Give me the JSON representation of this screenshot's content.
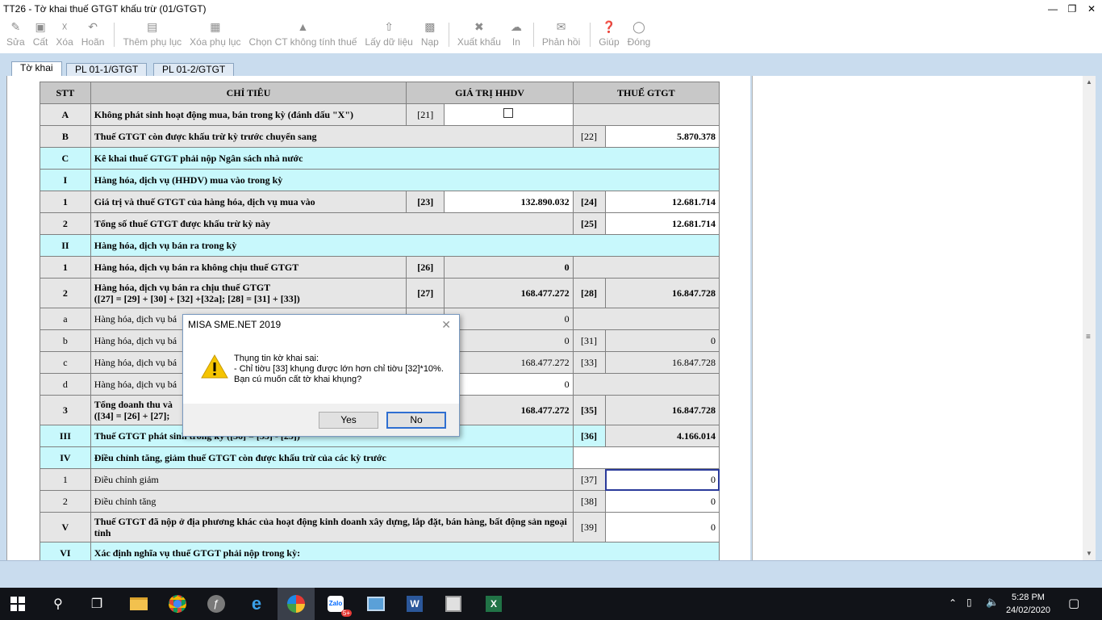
{
  "window": {
    "title": "TT26 - Tờ khai thuế GTGT khấu trừ (01/GTGT)"
  },
  "toolbar": {
    "items": [
      {
        "label": "Sửa",
        "icon": "edit-icon"
      },
      {
        "label": "Cất",
        "icon": "save-icon"
      },
      {
        "label": "Xóa",
        "icon": "delete-icon"
      },
      {
        "label": "Hoãn",
        "icon": "undo-icon"
      },
      {
        "label": "Thêm phụ lục",
        "icon": "add-appendix-icon"
      },
      {
        "label": "Xóa phụ lục",
        "icon": "delete-appendix-icon"
      },
      {
        "label": "Chọn CT không tính thuế",
        "icon": "select-document-icon"
      },
      {
        "label": "Lấy dữ liệu",
        "icon": "fetch-data-icon"
      },
      {
        "label": "Nạp",
        "icon": "load-icon"
      },
      {
        "label": "Xuất khẩu",
        "icon": "export-icon"
      },
      {
        "label": "In",
        "icon": "print-icon"
      },
      {
        "label": "Phản hồi",
        "icon": "feedback-icon"
      },
      {
        "label": "Giúp",
        "icon": "help-icon"
      },
      {
        "label": "Đóng",
        "icon": "close-form-icon"
      }
    ]
  },
  "tabs": [
    {
      "label": "Tờ khai",
      "active": true
    },
    {
      "label": "PL 01-1/GTGT",
      "active": false
    },
    {
      "label": "PL 01-2/GTGT",
      "active": false
    }
  ],
  "table": {
    "headers": {
      "stt": "STT",
      "chitieu": "CHỈ TIÊU",
      "giatri": "GIÁ TRỊ HHDV",
      "thue": "THUẾ GTGT"
    },
    "rows": {
      "A": {
        "stt": "A",
        "name": "Không phát sinh hoạt động mua, bán trong kỳ (đánh dấu \"X\")",
        "code1": "[21]"
      },
      "B": {
        "stt": "B",
        "name": "Thuế GTGT còn được khấu trừ kỳ trước chuyển sang",
        "code2": "[22]",
        "val2": "5.870.378"
      },
      "C": {
        "stt": "C",
        "name": "Kê khai thuế GTGT phải nộp Ngân sách nhà nước"
      },
      "I": {
        "stt": "I",
        "name": "Hàng hóa, dịch vụ (HHDV) mua vào trong kỳ"
      },
      "I1": {
        "stt": "1",
        "name": "Giá trị và thuế GTGT của hàng hóa, dịch vụ mua vào",
        "code1": "[23]",
        "val1": "132.890.032",
        "code2": "[24]",
        "val2": "12.681.714"
      },
      "I2": {
        "stt": "2",
        "name": "Tổng số thuế GTGT  được khấu trừ kỳ này",
        "code2": "[25]",
        "val2": "12.681.714"
      },
      "II": {
        "stt": "II",
        "name": "Hàng hóa, dịch vụ bán ra trong kỳ"
      },
      "II1": {
        "stt": "1",
        "name": "Hàng hóa, dịch vụ bán ra không chịu thuế GTGT",
        "code1": "[26]",
        "val1": "0"
      },
      "II2": {
        "stt": "2",
        "name": "Hàng hóa, dịch vụ bán ra chịu thuế GTGT",
        "name2": "([27] = [29] + [30] + [32] +[32a]; [28] = [31] + [33])",
        "code1": "[27]",
        "val1": "168.477.272",
        "code2": "[28]",
        "val2": "16.847.728"
      },
      "a": {
        "stt": "a",
        "name": "Hàng hóa, dịch vụ bá",
        "val1": "0"
      },
      "b": {
        "stt": "b",
        "name": "Hàng hóa, dịch vụ bá",
        "val1": "0",
        "code2": "[31]",
        "val2": "0"
      },
      "c": {
        "stt": "c",
        "name": "Hàng hóa, dịch vụ bá",
        "val1": "168.477.272",
        "code2": "[33]",
        "val2": "16.847.728"
      },
      "d": {
        "stt": "d",
        "name": "Hàng hóa, dịch vụ bá",
        "val1": "0"
      },
      "II3": {
        "stt": "3",
        "name": "Tổng doanh thu và",
        "name2": "([34] = [26] + [27];",
        "val1": "168.477.272",
        "code2": "[35]",
        "val2": "16.847.728"
      },
      "III": {
        "stt": "III",
        "name": "Thuế GTGT phát sinh trong kỳ ([36] = [35] - [25])",
        "code2": "[36]",
        "val2": "4.166.014"
      },
      "IV": {
        "stt": "IV",
        "name": "Điều chỉnh tăng, giảm thuế GTGT còn được khấu trừ của các kỳ trước"
      },
      "IV1": {
        "stt": "1",
        "name": "Điều chỉnh giảm",
        "code2": "[37]",
        "val2": "0"
      },
      "IV2": {
        "stt": "2",
        "name": "Điều chỉnh tăng",
        "code2": "[38]",
        "val2": "0"
      },
      "V": {
        "stt": "V",
        "name": "Thuế GTGT đã nộp ở địa phương khác của hoạt động kinh doanh xây dựng, lắp đặt, bán hàng, bất động sản ngoại tỉnh",
        "code2": "[39]",
        "val2": "0"
      },
      "VI": {
        "stt": "VI",
        "name": "Xác định nghĩa vụ thuế GTGT phải nộp trong kỳ:"
      }
    }
  },
  "dialog": {
    "title": "MISA SME.NET 2019",
    "line1": "Thụng tin kờ khai sai:",
    "line2": "- Chỉ tiờu [33] khụng được lớn hơn chỉ tiờu [32]*10%.",
    "line3": "Bạn cú muốn cất tờ khai khụng?",
    "yes": "Yes",
    "no": "No"
  },
  "taskbar": {
    "time": "5:28 PM",
    "date": "24/02/2020",
    "badge": "5+"
  }
}
